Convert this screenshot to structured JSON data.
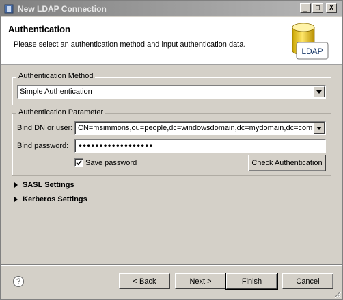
{
  "window": {
    "title": "New LDAP Connection",
    "controls": {
      "minimize": "_",
      "maximize": "□",
      "close": "X"
    }
  },
  "banner": {
    "title": "Authentication",
    "description": "Please select an authentication method and input authentication data.",
    "icon_label": "LDAP"
  },
  "auth_method": {
    "legend": "Authentication Method",
    "selected": "Simple Authentication"
  },
  "auth_param": {
    "legend": "Authentication Parameter",
    "bind_dn_label": "Bind DN or user:",
    "bind_dn_value": "CN=msimmons,ou=people,dc=windowsdomain,dc=mydomain,dc=com",
    "bind_pw_label": "Bind password:",
    "bind_pw_value": "••••••••••••••••••",
    "save_password_label": "Save password",
    "save_password_checked": true,
    "check_button": "Check Authentication"
  },
  "sections": {
    "sasl": "SASL Settings",
    "kerberos": "Kerberos Settings"
  },
  "footer": {
    "help": "?",
    "back": "< Back",
    "next": "Next >",
    "finish": "Finish",
    "cancel": "Cancel"
  }
}
